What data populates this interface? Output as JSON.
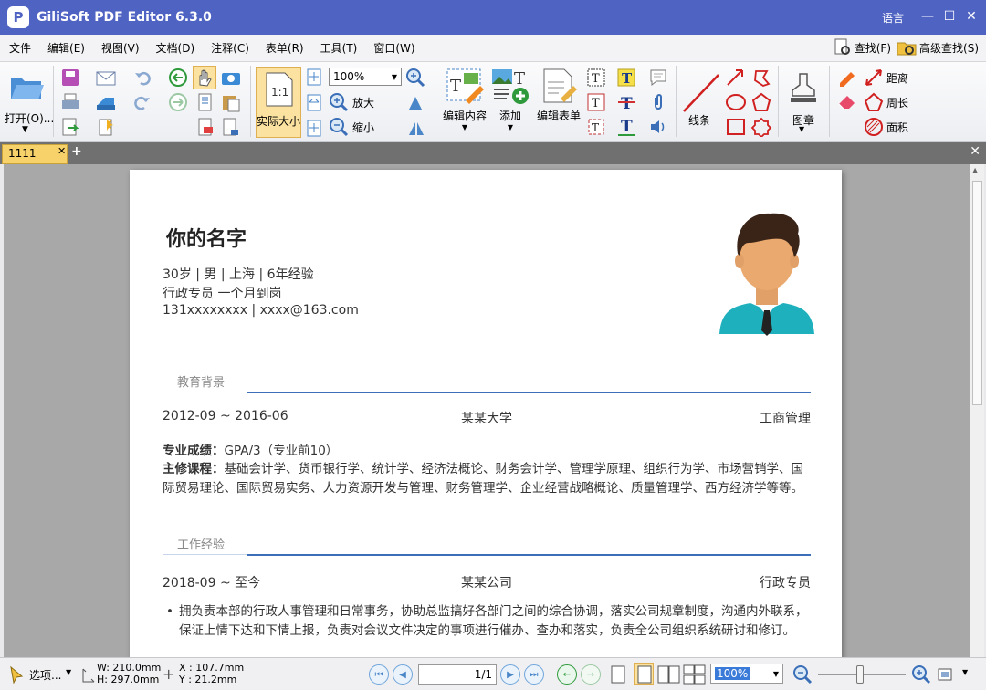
{
  "app": {
    "title": "GiliSoft PDF Editor 6.3.0",
    "language": "语言",
    "logo_letter": "P"
  },
  "menu": [
    "文件",
    "编辑(E)",
    "视图(V)",
    "文档(D)",
    "注释(C)",
    "表单(R)",
    "工具(T)",
    "窗口(W)"
  ],
  "search": {
    "find": "查找(F)",
    "advanced_find": "高级查找(S)"
  },
  "toolbar": {
    "open": "打开(O)...",
    "actual_size": "实际大小",
    "actual_size_icon_text": "1:1",
    "zoom_value": "100%",
    "zoom_in": "放大",
    "zoom_out": "缩小",
    "edit_content": "编辑内容",
    "add": "添加",
    "edit_form": "编辑表单",
    "line": "线条",
    "stamp": "图章",
    "distance": "距离",
    "perimeter": "周长",
    "area": "面积"
  },
  "tabs": {
    "doc_tab": "1111"
  },
  "resume": {
    "name": "你的名字",
    "line1": "30岁 | 男 | 上海 | 6年经验",
    "line2": "行政专员 一个月到岗",
    "line3": "131xxxxxxxx | xxxx@163.com",
    "education_title": "教育背景",
    "edu_period": "2012-09 ~ 2016-06",
    "edu_school": "某某大学",
    "edu_major": "工商管理",
    "grade_label": "专业成绩：",
    "grade_value": "GPA/3（专业前10）",
    "courses_label": "主修课程：",
    "courses_value": "基础会计学、货币银行学、统计学、经济法概论、财务会计学、管理学原理、组织行为学、市场营销学、国际贸易理论、国际贸易实务、人力资源开发与管理、财务管理学、企业经营战略概论、质量管理学、西方经济学等等。",
    "work_title": "工作经验",
    "work_period": "2018-09 ~ 至今",
    "work_company": "某某公司",
    "work_role": "行政专员",
    "work_bullet": "拥负责本部的行政人事管理和日常事务，协助总监搞好各部门之间的综合协调，落实公司规章制度，沟通内外联系，保证上情下达和下情上报，负责对会议文件决定的事项进行催办、查办和落实，负责全公司组织系统研讨和修订。"
  },
  "status": {
    "select": "选项...",
    "w": "W: 210.0mm",
    "h": "H: 297.0mm",
    "x": "X : 107.7mm",
    "y": "Y :   21.2mm",
    "page": "1/1",
    "zoom": "100%"
  }
}
